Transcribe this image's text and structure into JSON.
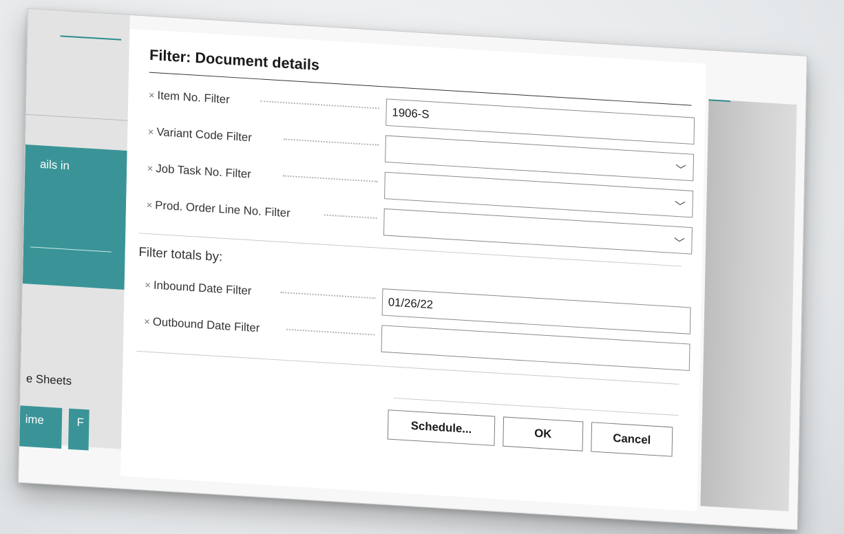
{
  "dialog": {
    "title": "Filter: Document details",
    "fields": [
      {
        "label": "Item No. Filter",
        "value": "1906-S",
        "has_dropdown": false
      },
      {
        "label": "Variant Code Filter",
        "value": "",
        "has_dropdown": true
      },
      {
        "label": "Job Task No. Filter",
        "value": "",
        "has_dropdown": true
      },
      {
        "label": "Prod. Order Line No. Filter",
        "value": "",
        "has_dropdown": true
      }
    ],
    "totals_section": "Filter totals by:",
    "totals_fields": [
      {
        "label": "Inbound Date Filter",
        "value": "01/26/22"
      },
      {
        "label": "Outbound Date Filter",
        "value": ""
      }
    ],
    "buttons": {
      "schedule": "Schedule...",
      "ok": "OK",
      "cancel": "Cancel"
    },
    "remove_icon": "×",
    "chevron_icon": "﹀"
  },
  "background": {
    "tile_text": "ails in",
    "sheets_text": "e Sheets",
    "btn1": "ime",
    "btn2": "F",
    "accent": "#3a9497"
  }
}
